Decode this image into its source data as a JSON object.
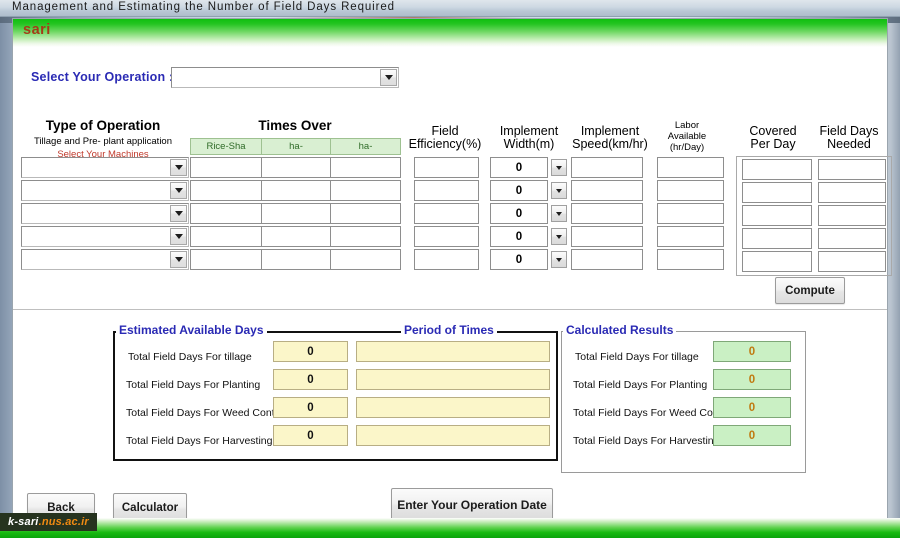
{
  "window": {
    "title": "Management and Estimating the Number of Field Days Required",
    "brand": "sari"
  },
  "operation_selector": {
    "label": "Select Your Operation :",
    "value": "",
    "placeholder": "",
    "caret_icon": "chevron-down-icon"
  },
  "grid": {
    "headers": {
      "type_of_operation": "Type of Operation",
      "type_of_operation_sub": "Tillage and Pre- plant application",
      "type_of_operation_hint": "Select Your Machines",
      "times_over": "Times Over",
      "field_efficiency": "Field\nEfficiency(%)",
      "field_efficiency_line1": "Field",
      "field_efficiency_line2": "Efficiency(%)",
      "implement_width_line1": "Implement",
      "implement_width_line2": "Width(m)",
      "implement_speed_line1": "Implement",
      "implement_speed_line2": "Speed(km/hr)",
      "labor_available_line1": "Labor",
      "labor_available_line2": "Available",
      "labor_available_line3": "(hr/Day)",
      "covered_per_day_line1": "Covered",
      "covered_per_day_line2": "Per Day",
      "field_days_needed_line1": "Field Days",
      "field_days_needed_line2": "Needed"
    },
    "times_over_subheaders": [
      "Rice-Sha",
      "ha-",
      "ha-"
    ],
    "rows": [
      {
        "machine": "",
        "times_over": [
          "",
          "",
          ""
        ],
        "field_efficiency": "",
        "implement_width": "0",
        "implement_speed": "",
        "labor_available": "",
        "covered_per_day": "",
        "field_days_needed": ""
      },
      {
        "machine": "",
        "times_over": [
          "",
          "",
          ""
        ],
        "field_efficiency": "",
        "implement_width": "0",
        "implement_speed": "",
        "labor_available": "",
        "covered_per_day": "",
        "field_days_needed": ""
      },
      {
        "machine": "",
        "times_over": [
          "",
          "",
          ""
        ],
        "field_efficiency": "",
        "implement_width": "0",
        "implement_speed": "",
        "labor_available": "",
        "covered_per_day": "",
        "field_days_needed": ""
      },
      {
        "machine": "",
        "times_over": [
          "",
          "",
          ""
        ],
        "field_efficiency": "",
        "implement_width": "0",
        "implement_speed": "",
        "labor_available": "",
        "covered_per_day": "",
        "field_days_needed": ""
      },
      {
        "machine": "",
        "times_over": [
          "",
          "",
          ""
        ],
        "field_efficiency": "",
        "implement_width": "0",
        "implement_speed": "",
        "labor_available": "",
        "covered_per_day": "",
        "field_days_needed": ""
      }
    ],
    "compute_button": "Compute"
  },
  "results": {
    "estimated_available_days_legend": "Estimated Available Days",
    "period_of_times_legend": "Period  of  Times",
    "calculated_results_legend": "Calculated Results",
    "left_rows": [
      {
        "label": "Total Field Days For  tillage",
        "days": "0",
        "period": ""
      },
      {
        "label": "Total Field Days For Planting",
        "days": "0",
        "period": ""
      },
      {
        "label": "Total Field Days For Weed Control",
        "days": "0",
        "period": ""
      },
      {
        "label": "Total Field Days For Harvesting",
        "days": "0",
        "period": ""
      }
    ],
    "right_rows": [
      {
        "label": "Total Field Days For  tillage",
        "value": "0"
      },
      {
        "label": "Total Field Days For Planting",
        "value": "0"
      },
      {
        "label": "Total Field Days For Weed Control",
        "value": "0"
      },
      {
        "label": "Total Field Days For Harvesting",
        "value": "0"
      }
    ]
  },
  "footer_buttons": {
    "back": "Back",
    "calculator": "Calculator",
    "enter_operation_date": "Enter Your Operation Date"
  },
  "footer_logo": {
    "part1": "k-sari",
    "part2": ".nus.ac.ir"
  },
  "colors": {
    "brand_green": "#0fbf10",
    "brand_red": "#a43c18",
    "legend_blue": "#2a2ab4",
    "hint_red": "#c0392b",
    "subheader_green_bg": "#d9efd2",
    "subheader_green_text": "#2f6b28",
    "yellow_field_bg": "#fbf6c9",
    "green_field_bg": "#caf0c4",
    "green_field_text": "#c07a10",
    "logo_orange": "#f08a12"
  }
}
